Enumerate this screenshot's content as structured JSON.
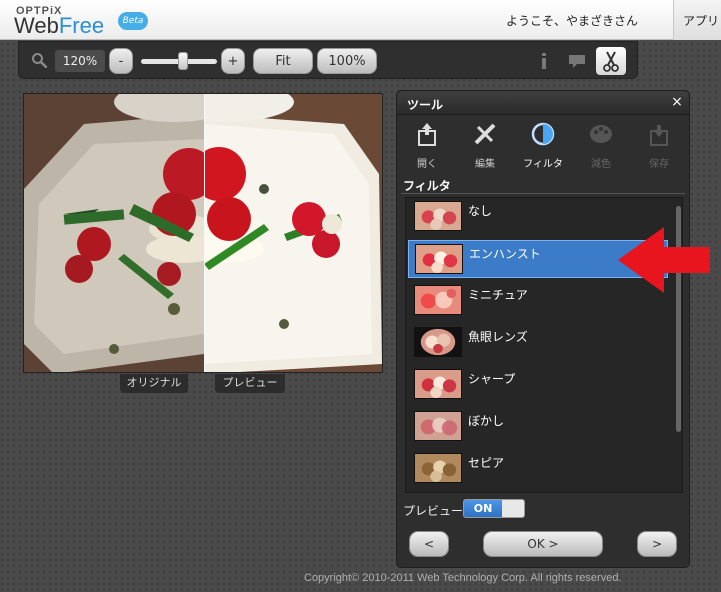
{
  "header": {
    "logo_top": "OPTPiX",
    "logo_web": "Web",
    "logo_free": "Free",
    "beta": "Beta",
    "welcome": "ようこそ、やまざきさん",
    "apps_tab": "アプリ"
  },
  "toolbar": {
    "zoom_value": "120%",
    "zoom_out": "-",
    "zoom_in": "+",
    "fit": "Fit",
    "actual": "100%",
    "slider_fraction": 0.55
  },
  "image": {
    "original_label": "オリジナル",
    "preview_label": "プレビュー"
  },
  "panel": {
    "title": "ツール",
    "close": "×",
    "tabs": [
      {
        "label": "開く",
        "icon": "open-icon",
        "state": "normal"
      },
      {
        "label": "編集",
        "icon": "edit-icon",
        "state": "normal"
      },
      {
        "label": "フィルタ",
        "icon": "filter-icon",
        "state": "active"
      },
      {
        "label": "減色",
        "icon": "palette-icon",
        "state": "disabled"
      },
      {
        "label": "保存",
        "icon": "save-icon",
        "state": "disabled"
      }
    ],
    "section_title": "フィルタ",
    "filters": [
      {
        "name": "なし",
        "selected": false
      },
      {
        "name": "エンハンスト",
        "selected": true
      },
      {
        "name": "ミニチュア",
        "selected": false
      },
      {
        "name": "魚眼レンズ",
        "selected": false
      },
      {
        "name": "シャープ",
        "selected": false
      },
      {
        "name": "ぼかし",
        "selected": false
      },
      {
        "name": "セピア",
        "selected": false
      }
    ],
    "preview_label": "プレビュー",
    "preview_toggle": "ON",
    "prev_button": "<",
    "ok_button": "OK >",
    "next_button": ">"
  },
  "footer": {
    "copyright": "Copyright© 2010-2011 Web Technology Corp. All rights reserved."
  },
  "colors": {
    "accent_blue": "#3b7bc8",
    "arrow_red": "#e8141e",
    "background": "#4a4a4a"
  }
}
